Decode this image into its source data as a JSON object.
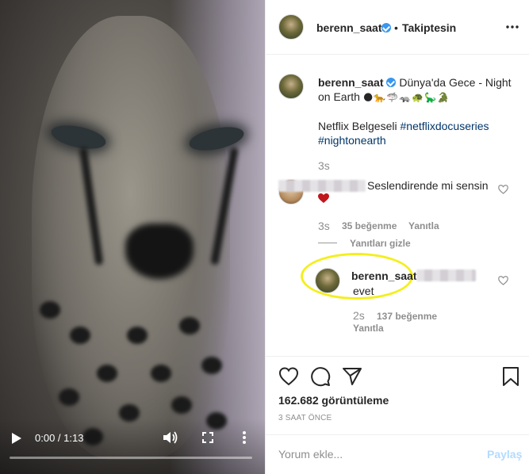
{
  "video": {
    "time_display": "0:00 / 1:13",
    "progress": 0.0
  },
  "post": {
    "username": "berenn_saat",
    "follow_status": "Takiptesin",
    "separator": "•",
    "caption": {
      "text": "Dünya'da Gece - Night on Earth",
      "emojis": "🌑🐆🦈🦡🐢🦕🐊",
      "subtitle": "Netflix Belgeseli",
      "tag1": "#netflixdocuseries",
      "tag2": "#nightonearth",
      "time": "3s"
    },
    "comments": [
      {
        "text": "Seslendirende mi sensin",
        "heart": "♥",
        "time": "3s",
        "likes": "35 beğenme",
        "reply_label": "Yanıtla"
      }
    ],
    "hide_replies": "Yanıtları gizle",
    "reply": {
      "username": "berenn_saat",
      "text": "evet",
      "time": "2s",
      "likes": "137 beğenme",
      "reply_label": "Yanıtla"
    },
    "views": "162.682 görüntüleme",
    "posted_ago": "3 SAAT ÖNCE",
    "comment_placeholder": "Yorum ekle...",
    "post_label": "Paylaş"
  },
  "colors": {
    "verified": "#3897f0",
    "highlight": "#f4ef1e",
    "tag": "#003569",
    "muted": "#8e8e8e",
    "post_disabled": "#b3dbff",
    "heart": "#c0161d"
  }
}
